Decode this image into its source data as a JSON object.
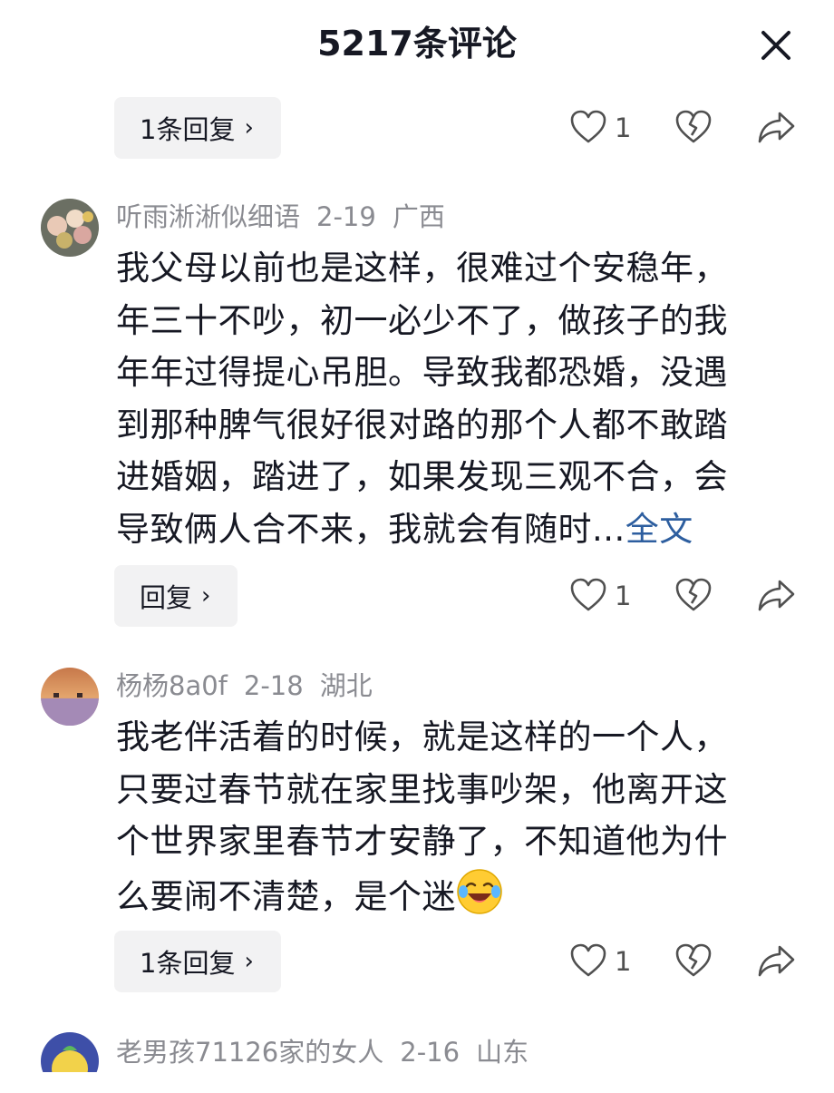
{
  "header": {
    "title": "5217条评论",
    "close_icon": "close-icon"
  },
  "top_actions": {
    "reply_label": "1条回复",
    "like_count": "1"
  },
  "comments": [
    {
      "username": "听雨淅淅似细语",
      "date": "2-19",
      "location": "广西",
      "text_lines": [
        "我父母以前也是这样，很难过个安稳年，",
        "年三十不吵，初一必少不了，做孩子的我",
        "年年过得提心吊胆。导致我都恐婚，没遇",
        "到那种脾气很好很对路的那个人都不敢踏",
        "进婚姻，踏进了，如果发现三观不合，会",
        "导致俩人合不来，我就会有随时..."
      ],
      "more_label": "全文",
      "reply_label": "回复",
      "like_count": "1"
    },
    {
      "username": "杨杨8a0f",
      "date": "2-18",
      "location": "湖北",
      "text_lines": [
        "我老伴活着的时候，就是这样的一个人，",
        "只要过春节就在家里找事吵架，他离开这",
        "个世界家里春节才安静了，不知道他为什",
        "么要闹不清楚，是个迷"
      ],
      "emoji": "laughing-crying-emoji",
      "reply_label": "1条回复",
      "like_count": "1"
    },
    {
      "username": "老男孩71126家的女人",
      "date": "2-16",
      "location": "山东"
    }
  ],
  "colors": {
    "text": "#161823",
    "meta": "#8a8b91",
    "link": "#2d5e9f",
    "button_bg": "#f2f2f3"
  }
}
